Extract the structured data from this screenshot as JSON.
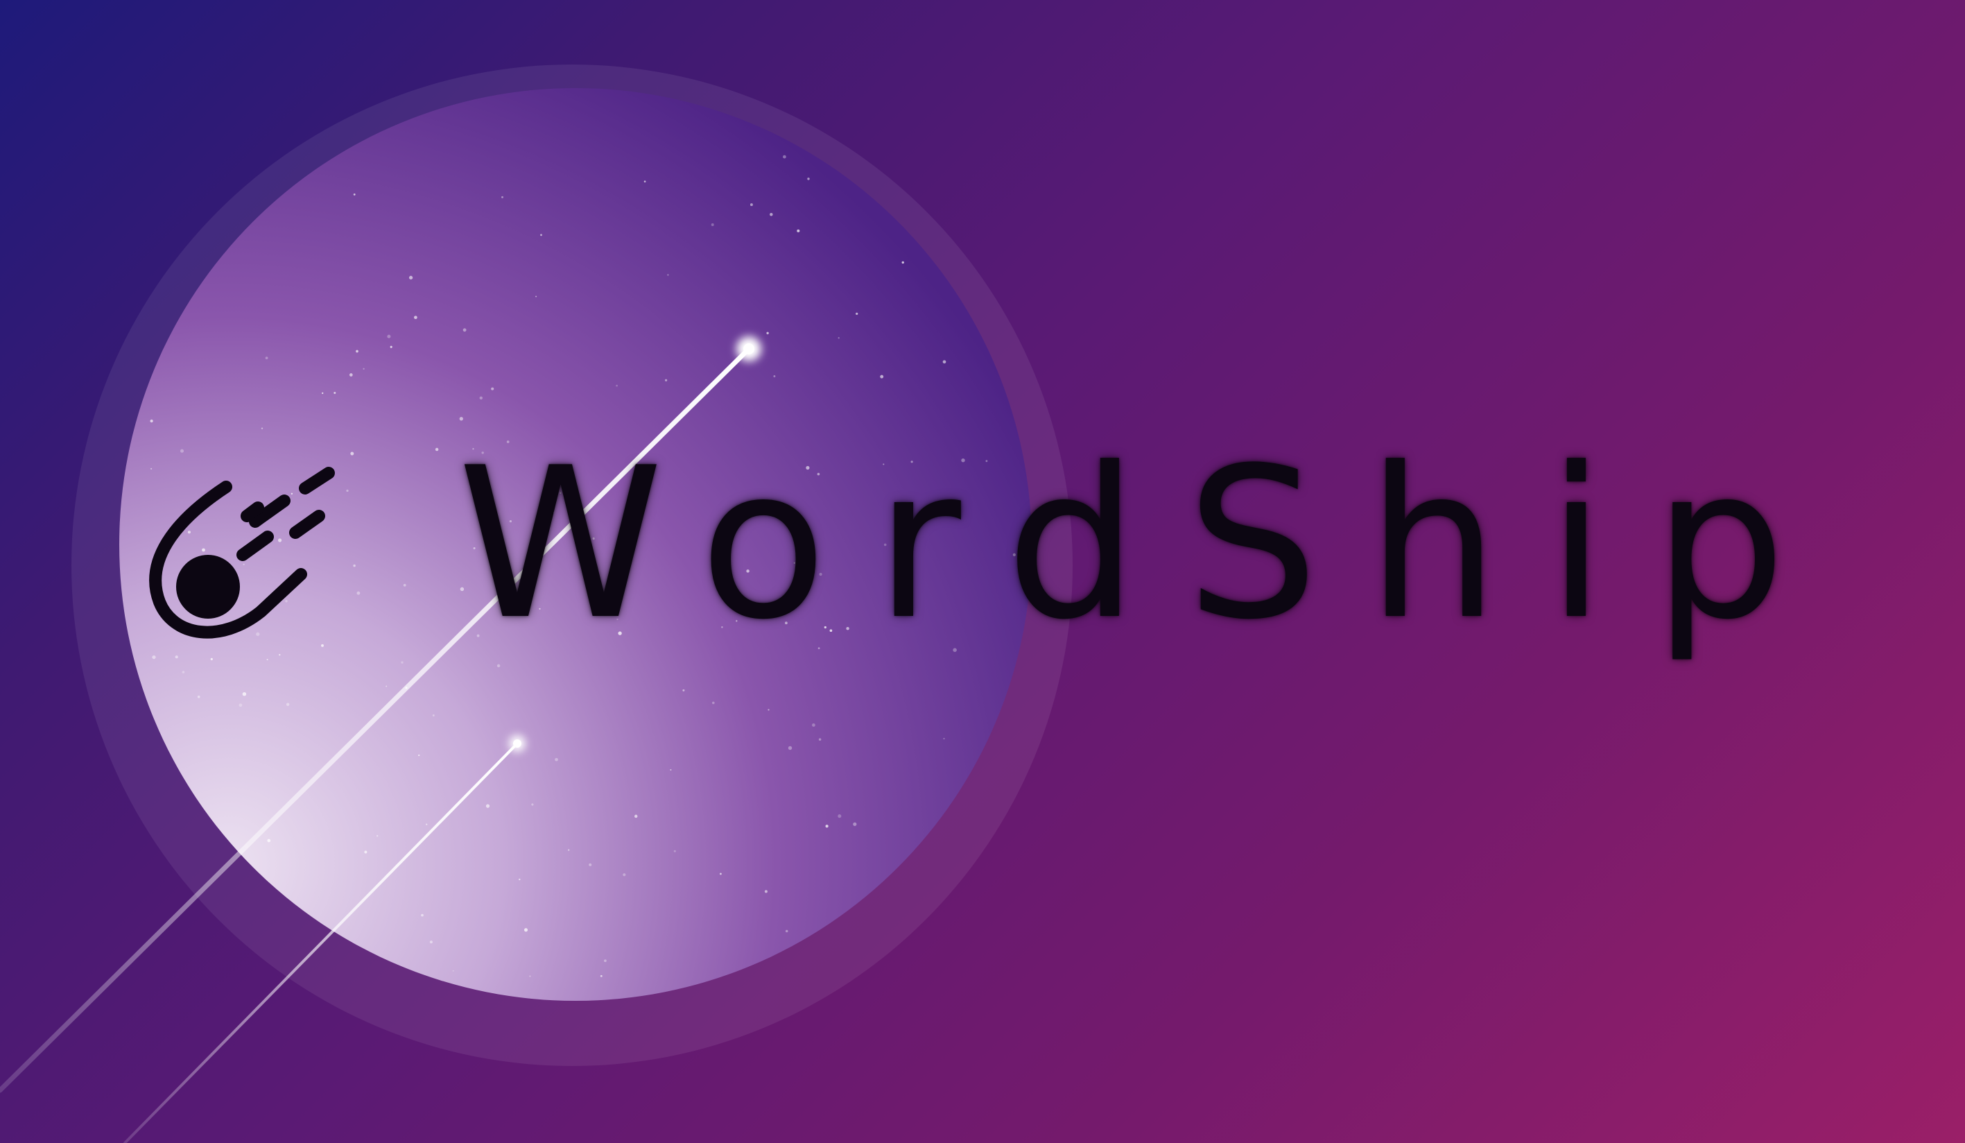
{
  "brand": {
    "name": "WordShip",
    "logo_icon": "meteor-icon"
  },
  "colors": {
    "background_start": "#1e1a7a",
    "background_mid": "#5a1a74",
    "background_end": "#9a1f68",
    "planet_light": "#e6d9ee",
    "planet_dark": "#5b2a8a",
    "wordmark": "#0c0612",
    "streak": "#ffffff"
  },
  "decorations": {
    "planet": "planet-shape",
    "streaks": [
      "shooting-star-long",
      "shooting-star-short"
    ],
    "stars": "starfield"
  }
}
